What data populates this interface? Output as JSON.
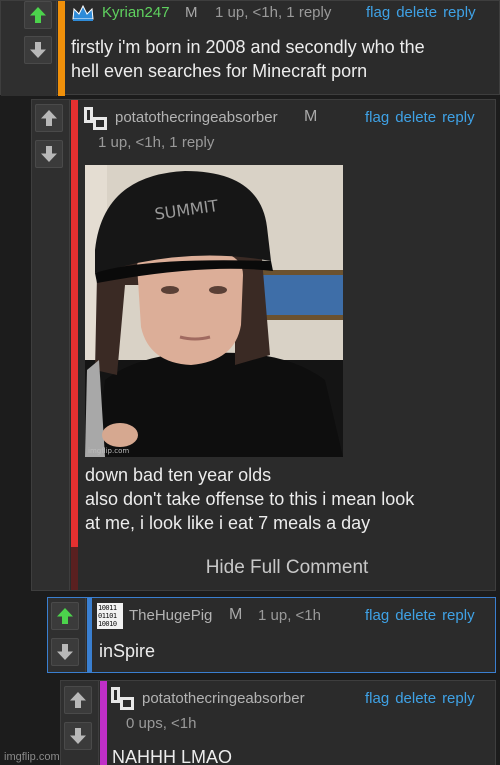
{
  "comments": [
    {
      "username": "Kyrian247",
      "mod_badge": "M",
      "meta": "1 up, <1h, 1 reply",
      "actions": [
        "flag",
        "delete",
        "reply"
      ],
      "text_lines": [
        "firstly i'm born in 2008 and secondly who the",
        "hell even searches for Minecraft porn"
      ],
      "accent_color": "#f0900a",
      "username_color": "#5fd15f",
      "upvoted": true,
      "avatar_icon": "crown-icon"
    },
    {
      "username": "potatothecringeabsorber",
      "mod_badge": "M",
      "meta": "1 up, <1h, 1 reply",
      "actions": [
        "flag",
        "delete",
        "reply"
      ],
      "text_lines": [
        "down bad ten year olds",
        "also don't take offense to this i mean look",
        "at me, i look like i eat 7 meals a day"
      ],
      "accent_color": "#e53030",
      "hide_full_label": "Hide Full Comment",
      "photo_watermark": "imgflip.com",
      "cap_text": "SUMMIT",
      "upvoted": false,
      "avatar_icon": "pixel-glyph-icon"
    },
    {
      "username": "TheHugePig",
      "mod_badge": "M",
      "meta": "1 up, <1h",
      "actions": [
        "flag",
        "delete",
        "reply"
      ],
      "text_lines": [
        "inSpire"
      ],
      "accent_color": "#3a7fd0",
      "upvoted": true,
      "avatar_icon": "binary-icon",
      "avatar_text": [
        "10011",
        "01101",
        "10010"
      ]
    },
    {
      "username": "potatothecringeabsorber",
      "meta": "0 ups, <1h",
      "actions": [
        "flag",
        "delete",
        "reply"
      ],
      "text_lines": [
        "NAHHH LMAO"
      ],
      "accent_color": "#c02fc8",
      "upvoted": false,
      "avatar_icon": "pixel-glyph-icon"
    }
  ],
  "footer_watermark": "imgflip.com",
  "colors": {
    "upvote_active": "#4cd34c",
    "arrow_inactive": "#b8b8b8",
    "link": "#3fa2e6"
  }
}
